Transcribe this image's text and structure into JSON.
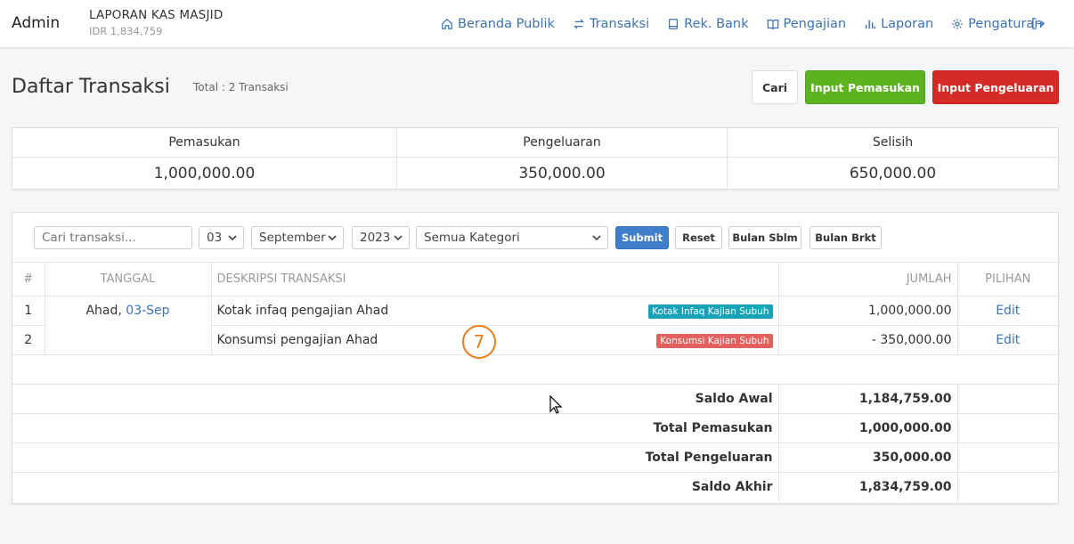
{
  "header": {
    "brand": "Admin",
    "org_name": "LAPORAN KAS MASJID",
    "org_balance": "IDR 1,834,759"
  },
  "nav": {
    "items": [
      {
        "label": "Beranda Publik",
        "icon": "home-icon"
      },
      {
        "label": "Transaksi",
        "icon": "exchange-icon"
      },
      {
        "label": "Rek. Bank",
        "icon": "book-icon"
      },
      {
        "label": "Pengajian",
        "icon": "open-book-icon"
      },
      {
        "label": "Laporan",
        "icon": "bar-chart-icon"
      },
      {
        "label": "Pengaturan",
        "icon": "gear-icon"
      }
    ],
    "logout_icon": "logout-icon"
  },
  "page": {
    "title": "Daftar Transaksi",
    "total": "Total : 2 Transaksi"
  },
  "actions": {
    "search": "Cari",
    "income": "Input Pemasukan",
    "expense": "Input Pengeluaran"
  },
  "summary": [
    {
      "label": "Pemasukan",
      "value": "1,000,000.00"
    },
    {
      "label": "Pengeluaran",
      "value": "350,000.00"
    },
    {
      "label": "Selisih",
      "value": "650,000.00"
    }
  ],
  "filters": {
    "search_placeholder": "Cari transaksi...",
    "day": "03",
    "month": "September",
    "year": "2023",
    "category": "Semua Kategori",
    "submit": "Submit",
    "reset": "Reset",
    "prev": "Bulan Sblm",
    "next": "Bulan Brkt"
  },
  "table": {
    "headers": {
      "no": "#",
      "date": "TANGGAL",
      "desc": "DESKRIPSI TRANSAKSI",
      "amount": "JUMLAH",
      "option": "PILIHAN"
    },
    "date_day": "Ahad,",
    "date_link": "03-Sep",
    "rows": [
      {
        "no": "1",
        "desc": "Kotak infaq pengajian Ahad",
        "badge": "Kotak Infaq Kajian Subuh",
        "amount": "1,000,000.00",
        "action": "Edit"
      },
      {
        "no": "2",
        "desc": "Konsumsi pengajian Ahad",
        "badge": "Konsumsi Kajian Subuh",
        "amount": "- 350,000.00",
        "action": "Edit"
      }
    ],
    "totals": [
      {
        "label": "Saldo Awal",
        "value": "1,184,759.00"
      },
      {
        "label": "Total Pemasukan",
        "value": "1,000,000.00"
      },
      {
        "label": "Total Pengeluaran",
        "value": "350,000.00"
      },
      {
        "label": "Saldo Akhir",
        "value": "1,834,759.00"
      }
    ]
  },
  "marker": "7",
  "colors": {
    "link": "#3b72b8",
    "income": "#5cb320",
    "expense": "#d52b27",
    "submit": "#3f7ecb",
    "badge_income": "#17a2b8",
    "badge_expense": "#e4605e",
    "marker": "#e87e1b"
  }
}
